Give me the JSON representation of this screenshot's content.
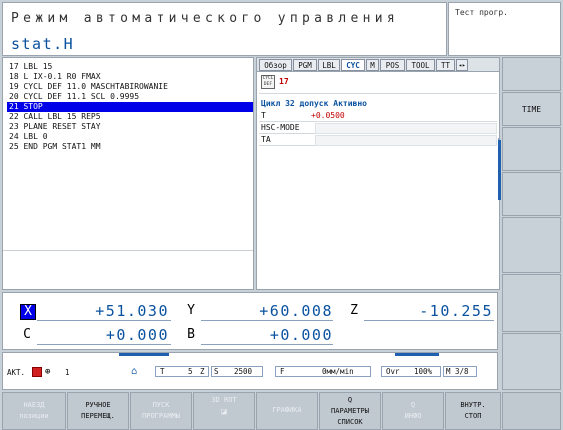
{
  "header": {
    "mode_title": "Режим автоматического управления",
    "file_name": "stat.H",
    "test_label": "Тест прогр."
  },
  "program": {
    "lines": [
      "17 LBL 15",
      "18 L IX-0.1 R0 FMAX",
      "19 CYCL DEF 11.0 MASCHTABIROWANIE",
      "20 CYCL DEF 11.1 SCL 0.9995",
      "21 STOP",
      "22 CALL LBL 15 REP5",
      "23 PLANE RESET STAY",
      "24 LBL 0",
      "25 END PGM STAT1 MM"
    ],
    "selected_index": 4
  },
  "status": {
    "tabs": [
      "Обзор",
      "PGM",
      "LBL",
      "CYC",
      "M",
      "POS",
      "TOOL",
      "TT"
    ],
    "active_tab": "CYC",
    "cycl_icon": "CYCL DEF",
    "cycle_number": "17",
    "cycle_header": "Цикл 32 допуск Активно",
    "rows": [
      {
        "label": "T",
        "value": "+0.0500"
      },
      {
        "label": "HSC-MODE",
        "value": ""
      },
      {
        "label": "TA",
        "value": ""
      }
    ]
  },
  "right_softkeys": [
    {
      "label": ""
    },
    {
      "label": "TIME"
    },
    {
      "label": ""
    },
    {
      "label": ""
    },
    {
      "label": ""
    },
    {
      "label": ""
    },
    {
      "label": ""
    }
  ],
  "axes": {
    "row1": [
      {
        "letter": "X",
        "value": "+51.030",
        "active": true
      },
      {
        "letter": "Y",
        "value": "+60.008",
        "active": false
      },
      {
        "letter": "Z",
        "value": "-10.255",
        "active": false
      }
    ],
    "row2": [
      {
        "letter": "C",
        "value": "+0.000",
        "active": false
      },
      {
        "letter": "B",
        "value": "+0.000",
        "active": false
      }
    ]
  },
  "statusbar": {
    "mode": "АКТ.",
    "number": "1",
    "t_label": "T",
    "tool": "5",
    "z_label": "Z",
    "s_label": "S",
    "spindle": "2500",
    "f_label": "F",
    "feed": "0мм/мin",
    "ovr_label": "Ovr",
    "ovr_value": "100%",
    "m_label": "M 3/8"
  },
  "bottom_softkeys": [
    {
      "line1": "НАЕЗД",
      "line2": "позиции",
      "enabled": false
    },
    {
      "line1": "РУЧНОЕ",
      "line2": "ПЕРЕМЕЩ.",
      "enabled": true
    },
    {
      "line1": "ПУСК",
      "line2": "ПРОГРАММЫ",
      "enabled": false
    },
    {
      "line1": "3D ROT",
      "line2": "",
      "enabled": false
    },
    {
      "line1": "ГРАФИКА",
      "line2": "",
      "enabled": false
    },
    {
      "line1": "ПАРАМЕТРЫ",
      "line2": "СПИСОК",
      "enabled": true,
      "top": "Q"
    },
    {
      "line1": "ИНФО",
      "line2": "",
      "enabled": false,
      "top": "Q"
    },
    {
      "line1": "ВНУТР.",
      "line2": "СТОП",
      "enabled": true
    }
  ],
  "colors": {
    "accent": "#0000e8",
    "value_blue": "#0a52a0",
    "red": "#c00000"
  }
}
